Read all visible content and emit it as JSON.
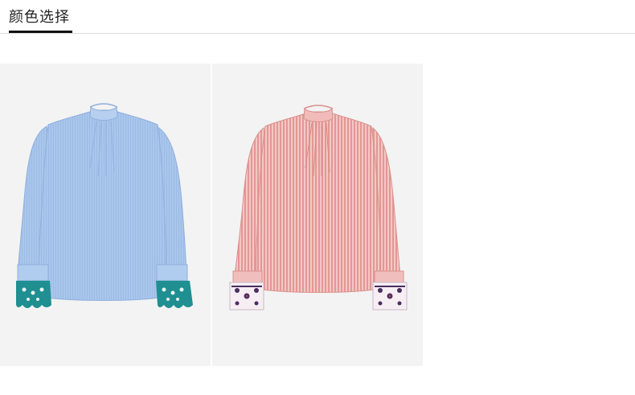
{
  "section": {
    "title": "颜色选择"
  },
  "colors": {
    "background": "#f3f3f3",
    "underline": "#111111",
    "blue_shirt": "#a9c6ec",
    "pink_shirt": "#eaa8a6",
    "blue_embroidery": "#1f8f91",
    "pink_embroidery": "#4a2e63"
  },
  "options": [
    {
      "icon": "blue-blouse-image"
    },
    {
      "icon": "pink-striped-blouse-image"
    }
  ]
}
